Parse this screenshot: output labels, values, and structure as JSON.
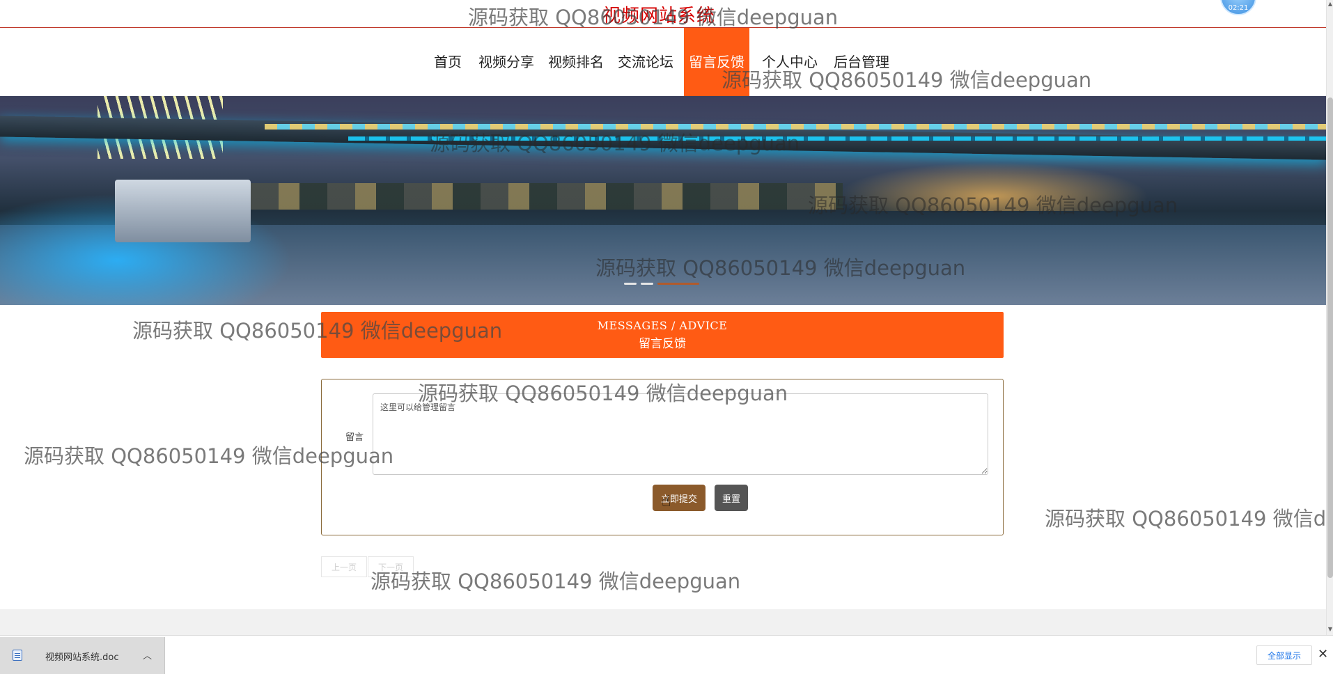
{
  "header": {
    "site_title": "视频网站系统",
    "avatar_text": "02:21"
  },
  "nav": {
    "items": [
      {
        "label": "首页"
      },
      {
        "label": "视频分享"
      },
      {
        "label": "视频排名"
      },
      {
        "label": "交流论坛"
      },
      {
        "label": "留言反馈",
        "active": true
      },
      {
        "label": "个人中心"
      },
      {
        "label": "后台管理"
      }
    ]
  },
  "banner": {
    "slide_count": 3,
    "current_slide": 3
  },
  "section": {
    "title_en": "MESSAGES / ADVICE",
    "title_cn": "留言反馈"
  },
  "form": {
    "label": "留言",
    "placeholder": "这里可以给管理留言",
    "value": "",
    "submit_label": "立即提交",
    "reset_label": "重置"
  },
  "pager": {
    "prev_label": "上一页",
    "next_label": "下一页"
  },
  "download_bar": {
    "file_name": "视频网站系统.doc",
    "show_all_label": "全部显示",
    "close_symbol": "✕",
    "chevron_symbol": "︿"
  },
  "watermark": {
    "text": "源码获取 QQ86050149 微信deepguan"
  },
  "colors": {
    "accent": "#ff5b14",
    "title_red": "#d60000",
    "submit_brown": "#8b5a2b",
    "reset_gray": "#555555"
  }
}
